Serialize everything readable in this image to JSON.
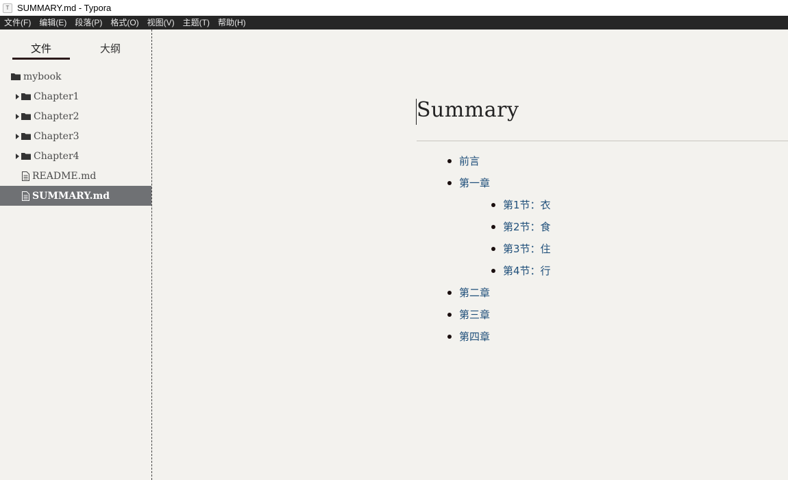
{
  "window": {
    "title": "SUMMARY.md - Typora",
    "app_icon_glyph": "T"
  },
  "menu": [
    "文件(F)",
    "编辑(E)",
    "段落(P)",
    "格式(O)",
    "视图(V)",
    "主题(T)",
    "帮助(H)"
  ],
  "sidebar": {
    "tabs": [
      "文件",
      "大纲"
    ],
    "active_tab": "文件",
    "root": "mybook",
    "folders": [
      "Chapter1",
      "Chapter2",
      "Chapter3",
      "Chapter4"
    ],
    "files": [
      "README.md",
      "SUMMARY.md"
    ],
    "active_file": "SUMMARY.md"
  },
  "document": {
    "heading": "Summary",
    "items": [
      {
        "label": "前言",
        "level": 1
      },
      {
        "label": "第一章",
        "level": 1
      },
      {
        "label": "第1节：衣",
        "level": 2
      },
      {
        "label": "第2节：食",
        "level": 2
      },
      {
        "label": "第3节：住",
        "level": 2
      },
      {
        "label": "第4节：行",
        "level": 2
      },
      {
        "label": "第二章",
        "level": 1
      },
      {
        "label": "第三章",
        "level": 1
      },
      {
        "label": "第四章",
        "level": 1
      }
    ]
  },
  "colors": {
    "link": "#1f4f7a",
    "active_row": "#6f7174",
    "menubar": "#262626",
    "background": "#f3f2ee"
  }
}
